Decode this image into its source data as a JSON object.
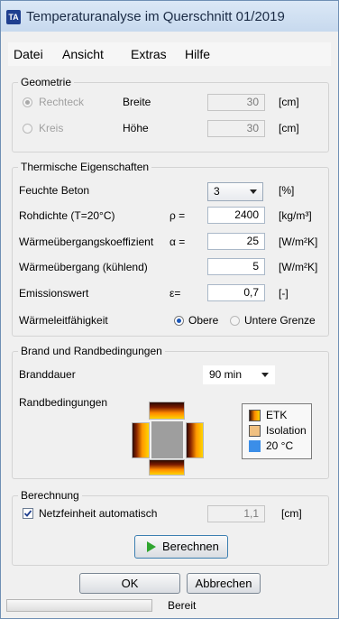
{
  "window": {
    "title": "Temperaturanalyse im Querschnitt 01/2019",
    "icon_text": "TA"
  },
  "menu": {
    "items": [
      "Datei",
      "Ansicht",
      "Extras",
      "Hilfe"
    ]
  },
  "geometry": {
    "legend": "Geometrie",
    "rect_label": "Rechteck",
    "circle_label": "Kreis",
    "width_label": "Breite",
    "width_value": "30",
    "height_label": "Höhe",
    "height_value": "30",
    "unit": "[cm]"
  },
  "thermal": {
    "legend": "Thermische Eigenschaften",
    "moisture_label": "Feuchte Beton",
    "moisture_value": "3",
    "moisture_unit": "[%]",
    "density_label": "Rohdichte (T=20°C)",
    "density_symbol": "ρ =",
    "density_value": "2400",
    "density_unit": "[kg/m³]",
    "htc_label": "Wärmeübergangskoeffizient",
    "htc_symbol": "α =",
    "htc_value": "25",
    "htc_unit": "[W/m²K]",
    "cool_label": "Wärmeübergang (kühlend)",
    "cool_value": "5",
    "cool_unit": "[W/m²K]",
    "emiss_label": "Emissionswert",
    "emiss_symbol": "ε=",
    "emiss_value": "0,7",
    "emiss_unit": "[-]",
    "cond_label": "Wärmeleitfähigkeit",
    "upper_label": "Obere",
    "lower_label": "Untere Grenze"
  },
  "fire": {
    "legend": "Brand und Randbedingungen",
    "duration_label": "Branddauer",
    "duration_value": "90 min",
    "boundary_label": "Randbedingungen",
    "legend_items": [
      "ETK",
      "Isolation",
      "20 °C"
    ],
    "colors": {
      "etk": "#ff8a00",
      "isolation": "#f0c080",
      "ambient": "#3b8ee8",
      "section": "#9e9e9e"
    }
  },
  "calc": {
    "legend": "Berechnung",
    "mesh_label": "Netzfeinheit automatisch",
    "mesh_value": "1,1",
    "mesh_unit": "[cm]",
    "run_label": "Berechnen"
  },
  "dialog": {
    "ok_label": "OK",
    "cancel_label": "Abbrechen"
  },
  "status": {
    "text": "Bereit"
  }
}
